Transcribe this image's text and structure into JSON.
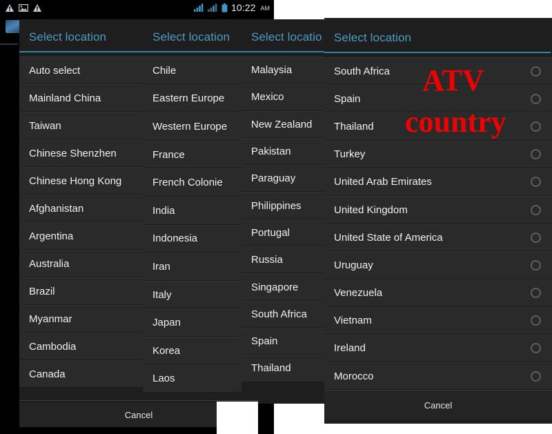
{
  "status_bar": {
    "icons": [
      "warning-triangle-icon",
      "image-icon",
      "warning-triangle-icon",
      "signal-bars-icon",
      "signal-bars-icon",
      "battery-icon"
    ],
    "time": "10:22",
    "ampm": "AM"
  },
  "annotation": {
    "line1": "ATV",
    "line2": "country",
    "color": "#ee0000"
  },
  "theme": {
    "title_color": "#4e9cc0",
    "rule_color": "#2e87a8",
    "row_bg": "#2a2a2a",
    "panel_bg": "#1e1e1e",
    "text_color": "#f0f0f0"
  },
  "panels": [
    {
      "title": "Select location",
      "cancel_label": "Cancel",
      "items": [
        "Auto select",
        "Mainland China",
        "Taiwan",
        "Chinese Shenzhen",
        "Chinese Hong Kong",
        "Afghanistan",
        "Argentina",
        "Australia",
        "Brazil",
        "Myanmar",
        "Cambodia",
        "Canada"
      ]
    },
    {
      "title": "Select location",
      "items": [
        "Chile",
        "Eastern Europe",
        "Western Europe",
        "France",
        "French Colonie",
        "India",
        "Indonesia",
        "Iran",
        "Italy",
        "Japan",
        "Korea",
        "Laos"
      ]
    },
    {
      "title": "Select locatio",
      "items": [
        "Malaysia",
        "Mexico",
        "New Zealand",
        "Pakistan",
        "Paraguay",
        "Philippines",
        "Portugal",
        "Russia",
        "Singapore",
        "South Africa",
        "Spain",
        "Thailand"
      ]
    },
    {
      "title": "Select location",
      "cancel_label": "Cancel",
      "items": [
        "South Africa",
        "Spain",
        "Thailand",
        "Turkey",
        "United Arab Emirates",
        "United Kingdom",
        "United State of America",
        "Uruguay",
        "Venezuela",
        "Vietnam",
        "Ireland",
        "Morocco"
      ]
    }
  ],
  "shared_footer": {
    "cancel_label": "Cancel"
  }
}
